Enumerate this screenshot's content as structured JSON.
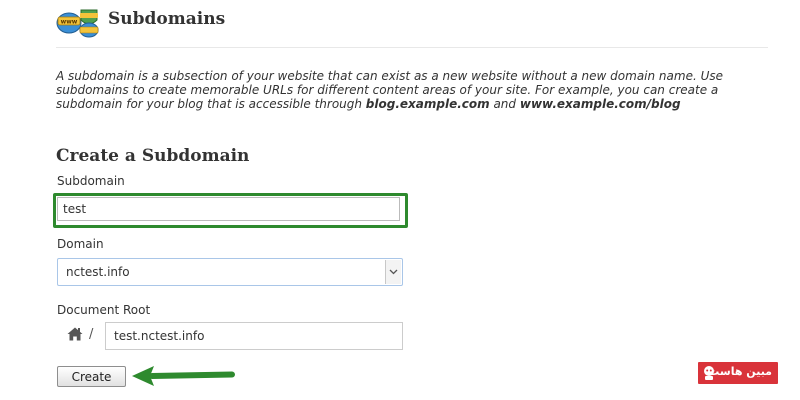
{
  "header": {
    "icon": "www-domains-icon",
    "title": "Subdomains"
  },
  "description": {
    "part1": "A subdomain is a subsection of your website that can exist as a new website without a new domain name. Use subdomains to create memorable URLs for different content areas of your site. For example, you can create a subdomain for your blog that is accessible through ",
    "example1": "blog.example.com",
    "and": " and ",
    "example2": "www.example.com/blog"
  },
  "form": {
    "section_title": "Create a Subdomain",
    "subdomain_label": "Subdomain",
    "subdomain_value": "test",
    "domain_label": "Domain",
    "domain_value": "nctest.info",
    "docroot_label": "Document Root",
    "docroot_home_icon": "home-icon",
    "docroot_slash": "/",
    "docroot_value": "test.nctest.info",
    "create_label": "Create"
  },
  "annotations": {
    "highlight_color": "#2e8a2e",
    "arrow_color": "#2e8a2e"
  },
  "watermark": {
    "text": "مبین هاست",
    "color": "#d9333a"
  }
}
